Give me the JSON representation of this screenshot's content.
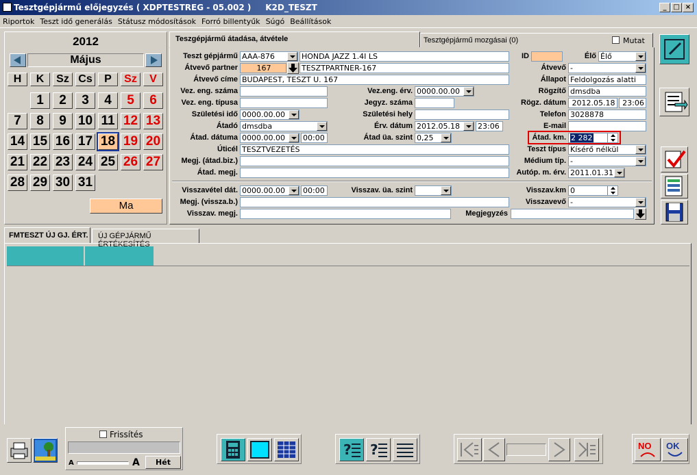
{
  "window": {
    "title": "Tesztgépjármű előjegyzés ( XDPTESTREG - 05.002 )     K2D_TESZT"
  },
  "menu": [
    "Riportok",
    "Teszt idő generálás",
    "Státusz módosítások",
    "Forró billentyűk",
    "Súgó",
    "Beállítások"
  ],
  "calendar": {
    "year": "2012",
    "month": "Május",
    "weekdays": [
      "H",
      "K",
      "Sz",
      "Cs",
      "P",
      "Sz",
      "V"
    ],
    "days": [
      "1",
      "2",
      "3",
      "4",
      "5",
      "6",
      "7",
      "8",
      "9",
      "10",
      "11",
      "12",
      "13",
      "14",
      "15",
      "16",
      "17",
      "18",
      "19",
      "20",
      "21",
      "22",
      "23",
      "24",
      "25",
      "26",
      "27",
      "28",
      "29",
      "30",
      "31"
    ],
    "today_button": "Ma"
  },
  "tabs": {
    "handover": "Teszgépjármű átadása, átvétele",
    "movements": "Tesztgépjármű mozgásai (0)",
    "show_label": "Mutat"
  },
  "form": {
    "vehicle_label": "Teszt gépjármű",
    "vehicle_code": "AAA-876",
    "vehicle_name": "HONDA JAZZ 1.4I LS",
    "id_label": "ID",
    "id_value": "",
    "live_label": "Élő",
    "live_value": "Élő",
    "partner_label": "Átvevő partner",
    "partner_code": "167",
    "partner_name": "TESZTPARTNER-167",
    "receiver_label": "Átvevő",
    "receiver_value": "-",
    "address_label": "Átvevő címe",
    "address_value": "BUDAPEST, TESZT U. 167",
    "status_label": "Állapot",
    "status_value": "Feldolgozás alatti",
    "license_no_label": "Vez. eng. száma",
    "license_no": "",
    "license_valid_label": "Vez.eng. érv.",
    "license_valid": "0000.00.00",
    "recorder_label": "Rögzítő",
    "recorder_value": "dmsdba",
    "license_type_label": "Vez. eng. típusa",
    "license_type": "",
    "minutes_no_label": "Jegyz. száma",
    "minutes_no": "",
    "rec_date_label": "Rögz. dátum",
    "rec_date": "2012.05.18",
    "rec_time": "23:06",
    "birth_date_label": "Születési idő",
    "birth_date": "0000.00.00",
    "birth_place_label": "Születési hely",
    "birth_place": "",
    "phone_label": "Telefon",
    "phone_value": "3028878",
    "handover_label": "Átadó",
    "handover_value": "dmsdba",
    "valid_date_label": "Érv. dátum",
    "valid_date": "2012.05.18",
    "valid_time": "23:06",
    "email_label": "E-mail",
    "email_value": "",
    "handover_date_label": "Átad. dátuma",
    "handover_date": "0000.00.00",
    "handover_time": "00:00",
    "fuel_label": "Átad üa. szint",
    "fuel_value": "0,25",
    "km_label": "Átad. km.",
    "km_value": "2 282",
    "destination_label": "Úticél",
    "destination_value": "TESZTVEZETÉS",
    "test_type_label": "Teszt típus",
    "test_type_value": "Kísérő nélkül",
    "note_biz_label": "Megj. (átad.biz.)",
    "note_biz": "",
    "medium_label": "Médium típ.",
    "medium_value": "-",
    "handover_note_label": "Átad. megj.",
    "handover_note": "",
    "autop_label": "Autóp. m. érv.",
    "autop_value": "2011.01.31",
    "return_date_label": "Visszavétel dát.",
    "return_date": "0000.00.00",
    "return_time": "00:00",
    "return_fuel_label": "Visszav. üa. szint",
    "return_fuel": "",
    "return_km_label": "Visszav.km",
    "return_km": "0",
    "return_note_b_label": "Megj. (vissza.b.)",
    "return_note_b": "",
    "return_receiver_label": "Visszavevő",
    "return_receiver": "-",
    "return_note_label": "Visszav. megj.",
    "return_note": "",
    "remark_label": "Megjegyzés",
    "remark": ""
  },
  "bottom_tabs": [
    "FMTESZT ÚJ GJ. ÉRT.",
    "ÚJ GÉPJÁRMŰ ÉRTÉKESÍTÉS"
  ],
  "footer": {
    "refresh_label": "Frissítés",
    "font_small": "A",
    "font_large": "A",
    "week_button": "Hét"
  },
  "colors": {
    "accent_orange": "#ffc896",
    "teal": "#3ab4b4",
    "highlight_red": "#e00000",
    "title_blue": "#0a246a"
  }
}
